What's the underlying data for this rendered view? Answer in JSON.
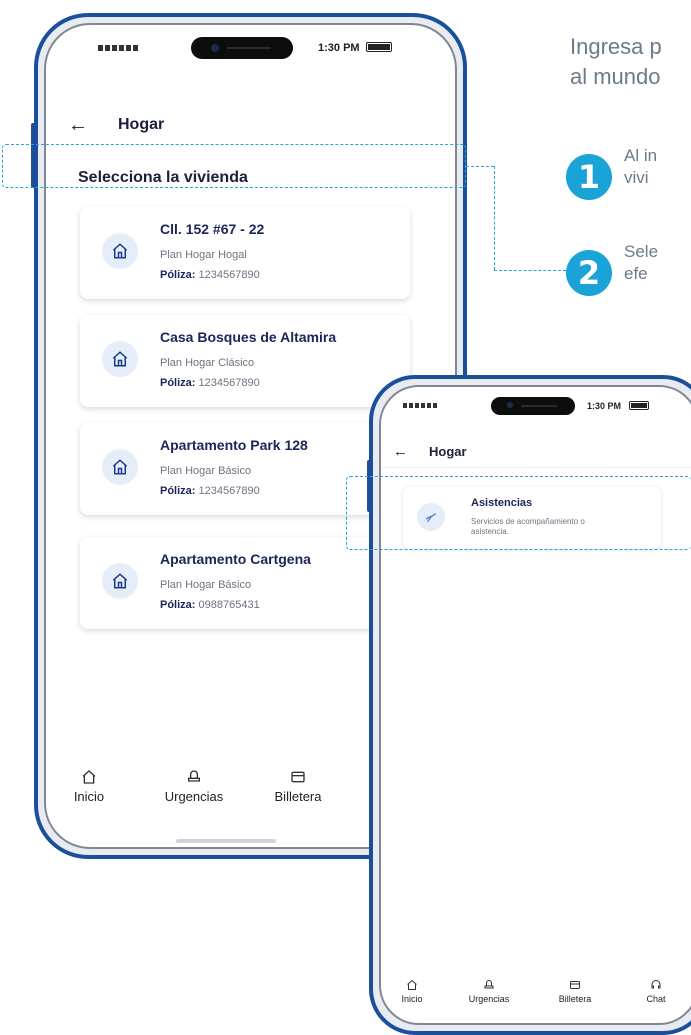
{
  "intro": {
    "line1": "Ingresa p",
    "line2": "al mundo"
  },
  "steps": [
    {
      "number": "1",
      "line1": "Al in",
      "line2": "vivi"
    },
    {
      "number": "2",
      "line1": "Sele",
      "line2": "efe"
    }
  ],
  "phone1": {
    "status_time": "1:30 PM",
    "title": "Hogar",
    "section_title": "Selecciona la vivienda",
    "policy_label": "Póliza:",
    "homes": [
      {
        "name": "Cll. 152 #67 - 22",
        "plan": "Plan Hogar Hogal",
        "policy": "1234567890"
      },
      {
        "name": "Casa Bosques de Altamira",
        "plan": "Plan Hogar Clásico",
        "policy": "1234567890"
      },
      {
        "name": "Apartamento Park 128",
        "plan": "Plan Hogar Básico",
        "policy": "1234567890"
      },
      {
        "name": "Apartamento Cartgena",
        "plan": "Plan Hogar Básico",
        "policy": "0988765431"
      }
    ],
    "tabs": {
      "home": "Inicio",
      "urgent": "Urgencias",
      "wallet": "Billetera"
    }
  },
  "phone2": {
    "status_time": "1:30 PM",
    "title": "Hogar",
    "service_title": "Asistencias",
    "service_desc_line1": "Servicios de acompañamiento o",
    "service_desc_line2": "asistencia.",
    "tabs": {
      "home": "Inicio",
      "urgent": "Urgencias",
      "wallet": "Billetera",
      "chat": "Chat"
    }
  },
  "colors": {
    "accent": "#1aa3d6",
    "frame": "#1a4f9c",
    "dashed": "#27a3d8",
    "title": "#1b2557"
  },
  "icons": [
    "back-arrow-icon",
    "house-icon",
    "assistance-icon",
    "home-tab-icon",
    "urgent-tab-icon",
    "wallet-tab-icon",
    "chat-tab-icon"
  ]
}
